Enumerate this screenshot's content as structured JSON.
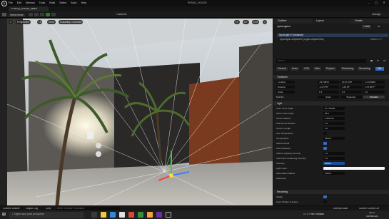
{
  "titlebar": {
    "logo": "U",
    "menu": [
      "File",
      "Edit",
      "Window",
      "Tools",
      "Build",
      "Select",
      "Actor",
      "Help"
    ],
    "window_title": "PFARQ_HOUSE",
    "project_tab": "PFARQ_HOUSE_MAIN",
    "min": "–",
    "max": "▢",
    "close": "✕"
  },
  "toolbar": {
    "select_mode": "Select Mode",
    "platforms": "Platforms",
    "settings": "Settings"
  },
  "viewport": {
    "perspective": "Perspective",
    "lit": "Lit",
    "show": "Show",
    "scalability": "Scalability: Cinematic",
    "numbers": [
      "10",
      "10°",
      "0.25",
      "4"
    ]
  },
  "outliner": {
    "tab": "Outliner",
    "layers": "Layers",
    "details": "Details"
  },
  "details": {
    "actor_name": "SpotLight17",
    "root": "SpotLight17 (Instance)",
    "component": "SpotLightComponent (LightComponent0)",
    "edit_in": "Edit in C++",
    "add": "+ Add",
    "search_placeholder": "Search",
    "filters": [
      "General",
      "Actor",
      "LOD",
      "Misc",
      "Physics",
      "Rendering",
      "Streaming",
      "All"
    ],
    "transform_header": "Transform",
    "location_label": "Location",
    "location": [
      "-19.72818",
      "1410.7307",
      "-11.104833"
    ],
    "rotation_label": "Rotation",
    "rotation": [
      "-4.27778°",
      "-144.87°",
      "-176.5277°"
    ],
    "scale_label": "Scale",
    "scale": [
      "1.0",
      "1.0",
      "1.0"
    ],
    "mobility_label": "Mobility",
    "mobility": [
      "Static",
      "Stationary",
      "Movable"
    ],
    "light_header": "Light",
    "props": [
      {
        "label": "Inner Cone Angle",
        "value": "37.715999"
      },
      {
        "label": "Outer Cone Angle",
        "value": "38.0"
      },
      {
        "label": "Source Radius",
        "value": "4.584735"
      },
      {
        "label": "Soft Source Radius",
        "value": "0.0"
      },
      {
        "label": "Source Length",
        "value": "0.0"
      },
      {
        "label": "Use Temperature",
        "value": ""
      },
      {
        "label": "Temperature",
        "value": "6500.0"
      },
      {
        "label": "Affects World",
        "value": ""
      },
      {
        "label": "Cast Shadows",
        "value": ""
      },
      {
        "label": "Indirect Lighting Intensity",
        "value": "1.0"
      },
      {
        "label": "Volumetric Scattering Intensity",
        "value": "1.0"
      },
      {
        "label": "Intensity",
        "value": "5000.0"
      },
      {
        "label": "Light Color",
        "value": ""
      },
      {
        "label": "Attenuation Radius",
        "value": "1000.0"
      }
    ],
    "advanced": "Advanced",
    "rendering_header": "Rendering",
    "visible_label": "Visible",
    "actor_hidden_label": "Actor Hidden In Game"
  },
  "bottom": {
    "content_drawer": "Content Drawer",
    "output_log": "Output Log",
    "cmd": "Cmd",
    "console_placeholder": "Enter Console Command",
    "derived_data": "Derived Data",
    "source_control": "Source Control Off"
  },
  "taskbar": {
    "search_placeholder": "Digite aqui para pesquisar",
    "weather": "17°C Prev. nublado",
    "time": "16:27",
    "date": "16/04/2022"
  }
}
